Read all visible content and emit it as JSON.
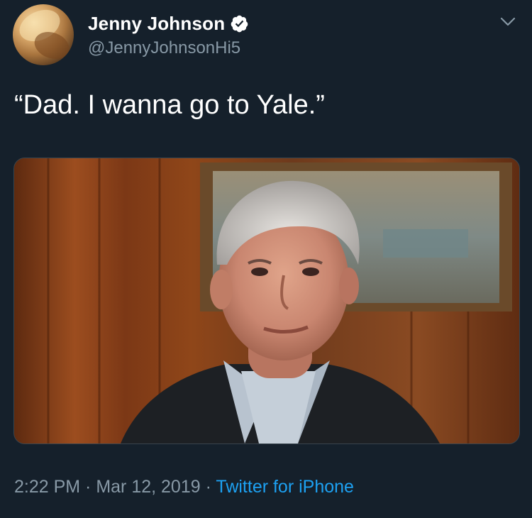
{
  "tweet": {
    "author": {
      "display_name": "Jenny Johnson",
      "handle": "@JennyJohnsonHi5",
      "verified": true,
      "avatar_icon": "profile-photo"
    },
    "text": "“Dad. I wanna go to Yale.”",
    "media": {
      "type": "photo",
      "alt_subject": "man in front of wood panel wall"
    },
    "meta": {
      "time": "2:22 PM",
      "separator1": " · ",
      "date": "Mar 12, 2019",
      "separator2": " · ",
      "source": "Twitter for iPhone"
    },
    "menu_icon": "chevron-down-icon"
  },
  "colors": {
    "background": "#15202b",
    "secondary_text": "#8899a6",
    "link": "#1da1f2",
    "verified_badge": "#ffffff"
  }
}
